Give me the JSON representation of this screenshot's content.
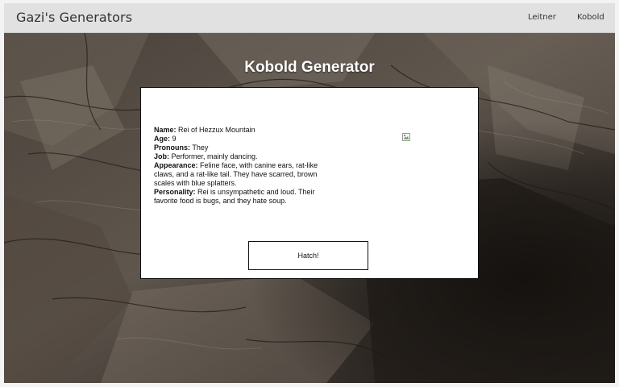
{
  "navbar": {
    "brand": "Gazi's Generators",
    "links": [
      "Leitner",
      "Kobold"
    ]
  },
  "page": {
    "title": "Kobold Generator"
  },
  "kobold": {
    "name_label": "Name:",
    "name": "Rei of Hezzux Mountain",
    "age_label": "Age:",
    "age": "9",
    "pronouns_label": "Pronouns:",
    "pronouns": "They",
    "job_label": "Job:",
    "job": "Performer, mainly dancing.",
    "appearance_label": "Appearance:",
    "appearance": "Feline face, with canine ears, rat-like claws, and a rat-like tail. They have scarred, brown scales with blue splatters.",
    "personality_label": "Personality:",
    "personality": "Rei is unsympathetic and loud. Their favorite food is bugs, and they hate soup."
  },
  "actions": {
    "hatch_label": "Hatch!"
  },
  "icons": {
    "kobold_image": "broken-image-icon"
  },
  "colors": {
    "navbar_bg": "#e1e1e1",
    "rock_dark": "#2b2622",
    "rock_light": "#6e655c"
  }
}
